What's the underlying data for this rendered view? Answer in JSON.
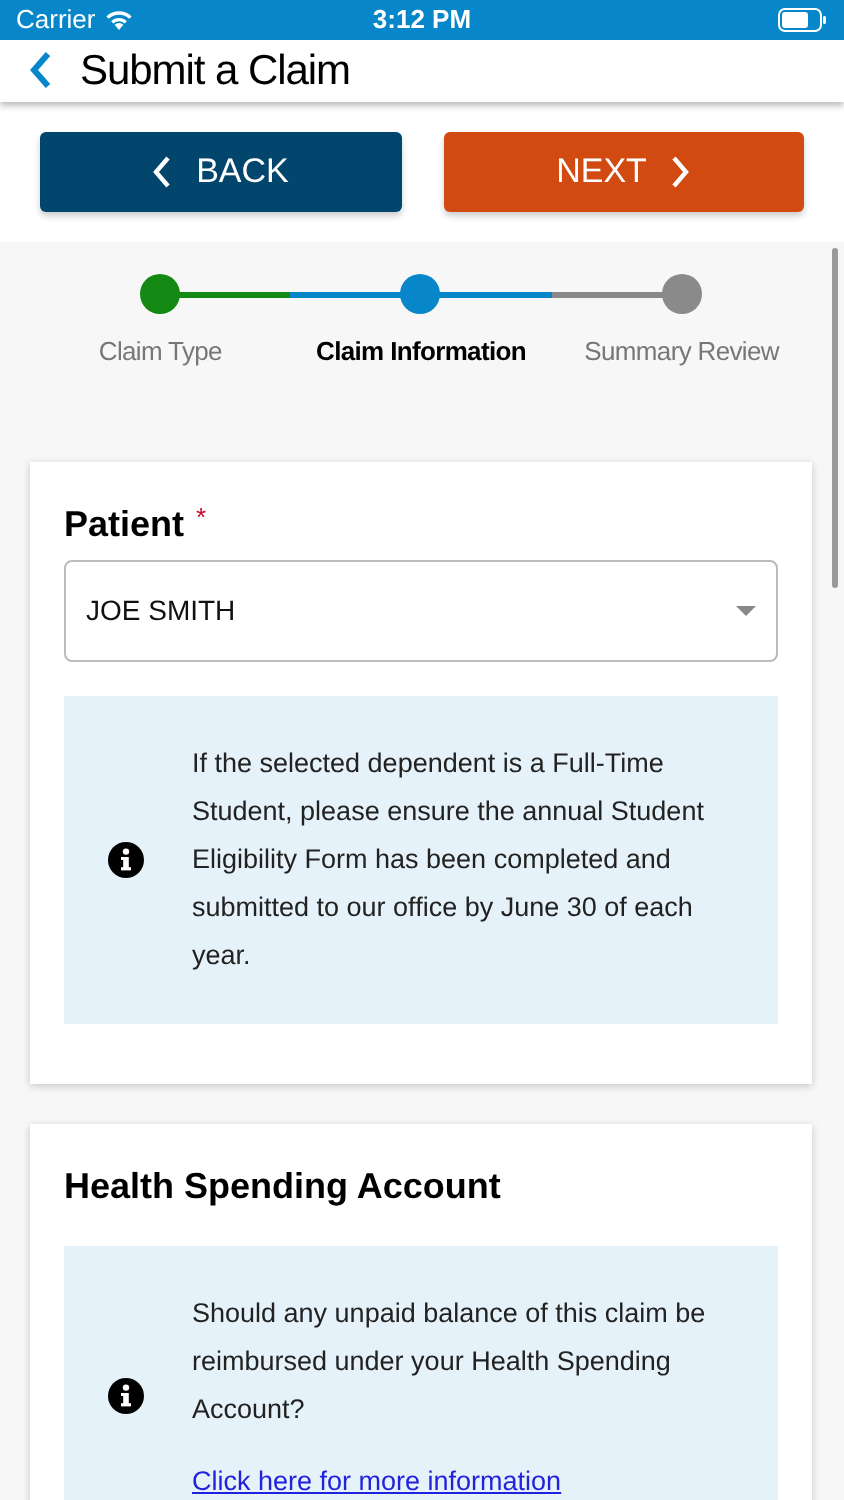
{
  "status_bar": {
    "carrier": "Carrier",
    "time": "3:12 PM"
  },
  "header": {
    "title": "Submit a Claim"
  },
  "nav_buttons": [
    {
      "kind": "back",
      "label": "BACK"
    },
    {
      "kind": "next",
      "label": "NEXT"
    }
  ],
  "steps": [
    {
      "label": "Claim Type",
      "completed": true,
      "selected": false
    },
    {
      "label": "Claim Information",
      "completed": false,
      "selected": true
    },
    {
      "label": "Summary Review",
      "completed": false,
      "selected": false
    }
  ],
  "patient": {
    "label": "Patient",
    "required_mark": "*",
    "value": "JOE SMITH",
    "notice": "If the selected dependent is a Full-Time Student, please ensure the annual Student Eligibility Form has been completed and submitted to our office by June 30 of each year."
  },
  "health_spending": {
    "title": "Health Spending Account",
    "notice": "Should any unpaid balance of this claim be reimbursed under your Health Spending Account?",
    "link": "Click here for more information"
  }
}
